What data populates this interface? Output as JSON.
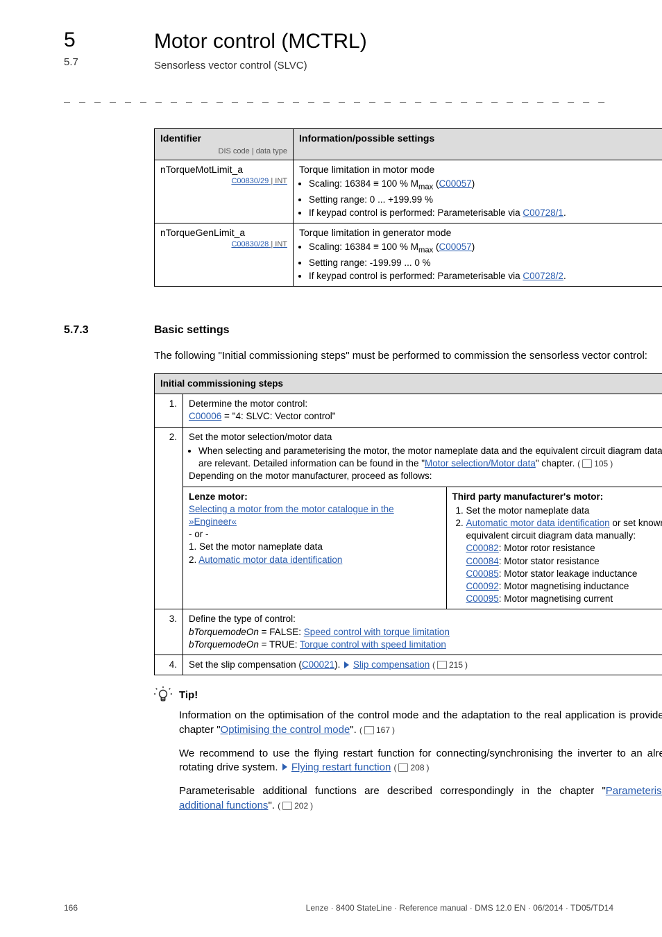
{
  "header": {
    "chapter_num": "5",
    "chapter_title": "Motor control (MCTRL)",
    "sec_num": "5.7",
    "sec_title": "Sensorless vector control (SLVC)"
  },
  "spec_table": {
    "headers": {
      "col1": "Identifier",
      "col1_sub": "DIS code | data type",
      "col2": "Information/possible settings"
    },
    "rows": [
      {
        "ident": "nTorqueMotLimit_a",
        "code": "C00830/29",
        "suffix": " | INT",
        "desc_title": "Torque limitation in motor mode",
        "b1a": "Scaling: 16384 ≡ 100 % M",
        "b1sub": "max",
        "b1b": " (",
        "b1link": "C00057",
        "b1c": ")",
        "b2": "Setting range: 0 ... +199.99 %",
        "b3a": "If keypad control is performed: Parameterisable via ",
        "b3link": "C00728/1",
        "b3c": "."
      },
      {
        "ident": "nTorqueGenLimit_a",
        "code": "C00830/28",
        "suffix": " | INT",
        "desc_title": "Torque limitation in generator mode",
        "b1a": "Scaling: 16384 ≡ 100 % M",
        "b1sub": "max",
        "b1b": " (",
        "b1link": "C00057",
        "b1c": ")",
        "b2": "Setting range: -199.99 ... 0 %",
        "b3a": "If keypad control is performed: Parameterisable via ",
        "b3link": "C00728/2",
        "b3c": "."
      }
    ]
  },
  "section": {
    "num": "5.7.3",
    "title": "Basic settings",
    "intro": "The following \"Initial commissioning steps\" must be performed to commission the sensorless vector control:"
  },
  "steps_table": {
    "header": "Initial commissioning steps",
    "rows": [
      {
        "n": "1.",
        "l1": "Determine the motor control:",
        "l2link": "C00006",
        "l2rest": " = \"4: SLVC: Vector control\""
      },
      {
        "n": "2.",
        "l1": "Set the motor selection/motor data",
        "bullet_a": "When selecting and parameterising the motor, the motor nameplate data and the equivalent circuit diagram data are relevant. Detailed information can be found in the \"",
        "bullet_link": "Motor selection/Motor data",
        "bullet_b": "\" chapter. ",
        "bullet_page": "105",
        "l_depend": "Depending on the motor manufacturer, proceed as follows:",
        "left_h": "Lenze motor:",
        "left_link": "Selecting a motor from the motor catalogue in the »Engineer«",
        "left_or": "- or -",
        "left_o1": "1. Set the motor nameplate data",
        "left_o2a": "2. ",
        "left_o2link": "Automatic motor data identification",
        "right_h": "Third party manufacturer's motor:",
        "r1": "Set the motor nameplate data",
        "r2link": "Automatic motor data identification",
        "r2rest": " or set known equivalent circuit diagram data manually:",
        "rc1": "C00082",
        "rc1t": ": Motor rotor resistance",
        "rc2": "C00084",
        "rc2t": ": Motor stator resistance",
        "rc3": "C00085",
        "rc3t": ": Motor stator leakage inductance",
        "rc4": "C00092",
        "rc4t": ": Motor magnetising inductance",
        "rc5": "C00095",
        "rc5t": ": Motor magnetising current"
      },
      {
        "n": "3.",
        "l1": "Define the type of control:",
        "l2i": "bTorquemodeOn",
        "l2a": " = FALSE: ",
        "l2link": "Speed control with torque limitation",
        "l3i": "bTorquemodeOn",
        "l3a": " = TRUE: ",
        "l3link": "Torque control with speed limitation"
      },
      {
        "n": "4.",
        "l1a": "Set the slip compensation (",
        "l1link1": "C00021",
        "l1b": "). ",
        "l1link2": "Slip compensation",
        "l1page": "215"
      }
    ]
  },
  "tip": {
    "label": "Tip!",
    "p1a": "Information on the optimisation of the control mode and the adaptation to the real application is provided in chapter \"",
    "p1link": "Optimising the control mode",
    "p1b": "\". ",
    "p1page": "167",
    "p2a": "We recommend to use the flying restart function for connecting/synchronising the inverter to an already rotating drive system. ",
    "p2link": "Flying restart function",
    "p2page": "208",
    "p3a": "Parameterisable additional functions are described correspondingly in the chapter \"",
    "p3link": "Parameterisable additional functions",
    "p3b": "\". ",
    "p3page": "202"
  },
  "footer": {
    "page": "166",
    "right": "Lenze · 8400 StateLine · Reference manual · DMS 12.0 EN · 06/2014 · TD05/TD14"
  }
}
